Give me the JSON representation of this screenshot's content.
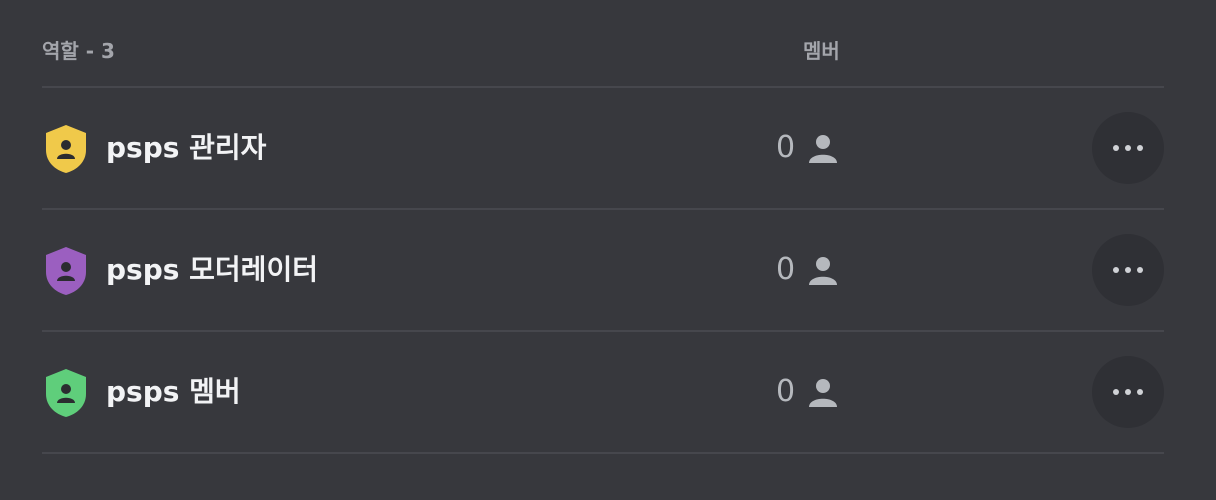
{
  "header": {
    "roles_label": "역할 - 3",
    "members_label": "멤버"
  },
  "roles": [
    {
      "name": "psps 관리자",
      "member_count": "0",
      "color": "#f0c94a",
      "icon": "shield-person-icon"
    },
    {
      "name": "psps 모더레이터",
      "member_count": "0",
      "color": "#9b5fc0",
      "icon": "shield-person-icon"
    },
    {
      "name": "psps 멤버",
      "member_count": "0",
      "color": "#5fce7b",
      "icon": "shield-person-icon"
    }
  ],
  "icons": {
    "member": "person-icon",
    "more": "more-horizontal-icon"
  }
}
